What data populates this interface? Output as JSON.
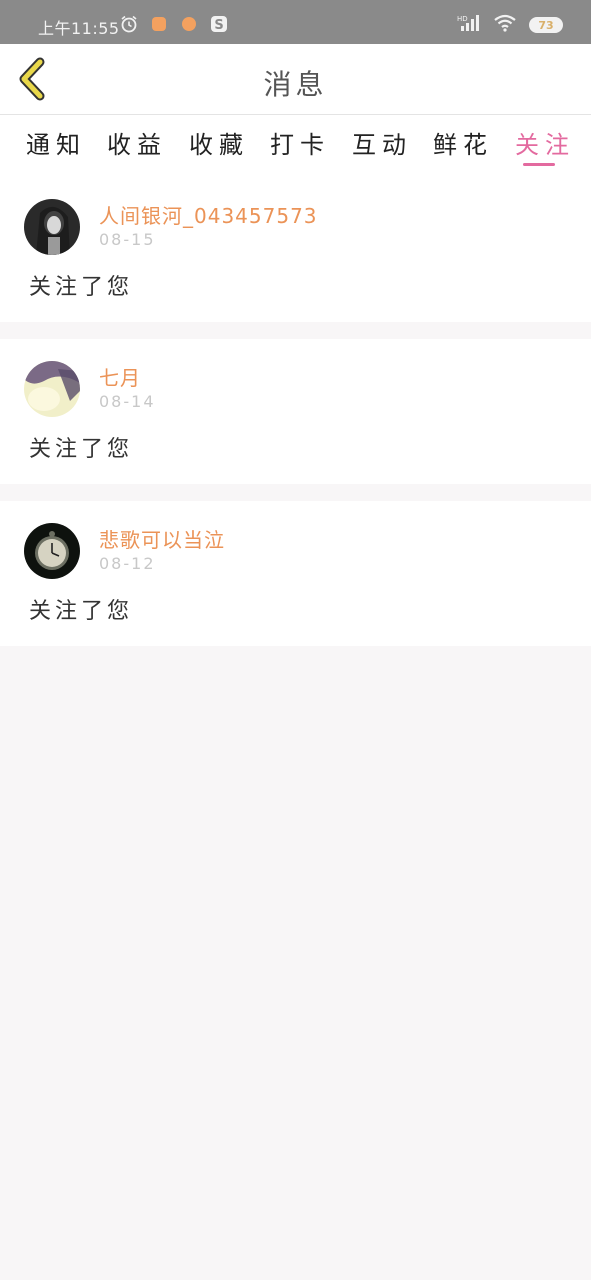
{
  "status_bar": {
    "time": "上午11:55",
    "battery": "73",
    "network_label": "HD"
  },
  "header": {
    "title": "消息"
  },
  "tabs": [
    {
      "label": "通知"
    },
    {
      "label": "收益"
    },
    {
      "label": "收藏"
    },
    {
      "label": "打卡"
    },
    {
      "label": "互动"
    },
    {
      "label": "鲜花"
    },
    {
      "label": "关注",
      "active": true
    }
  ],
  "messages": [
    {
      "username": "人间银河_043457573",
      "date": "08-15",
      "text": "关注了您"
    },
    {
      "username": "七月",
      "date": "08-14",
      "text": "关注了您"
    },
    {
      "username": "悲歌可以当泣",
      "date": "08-12",
      "text": "关注了您"
    }
  ],
  "colors": {
    "accent_pink": "#e36a9f",
    "username_orange": "#eb9357",
    "back_arrow_yellow": "#e9d84a"
  }
}
